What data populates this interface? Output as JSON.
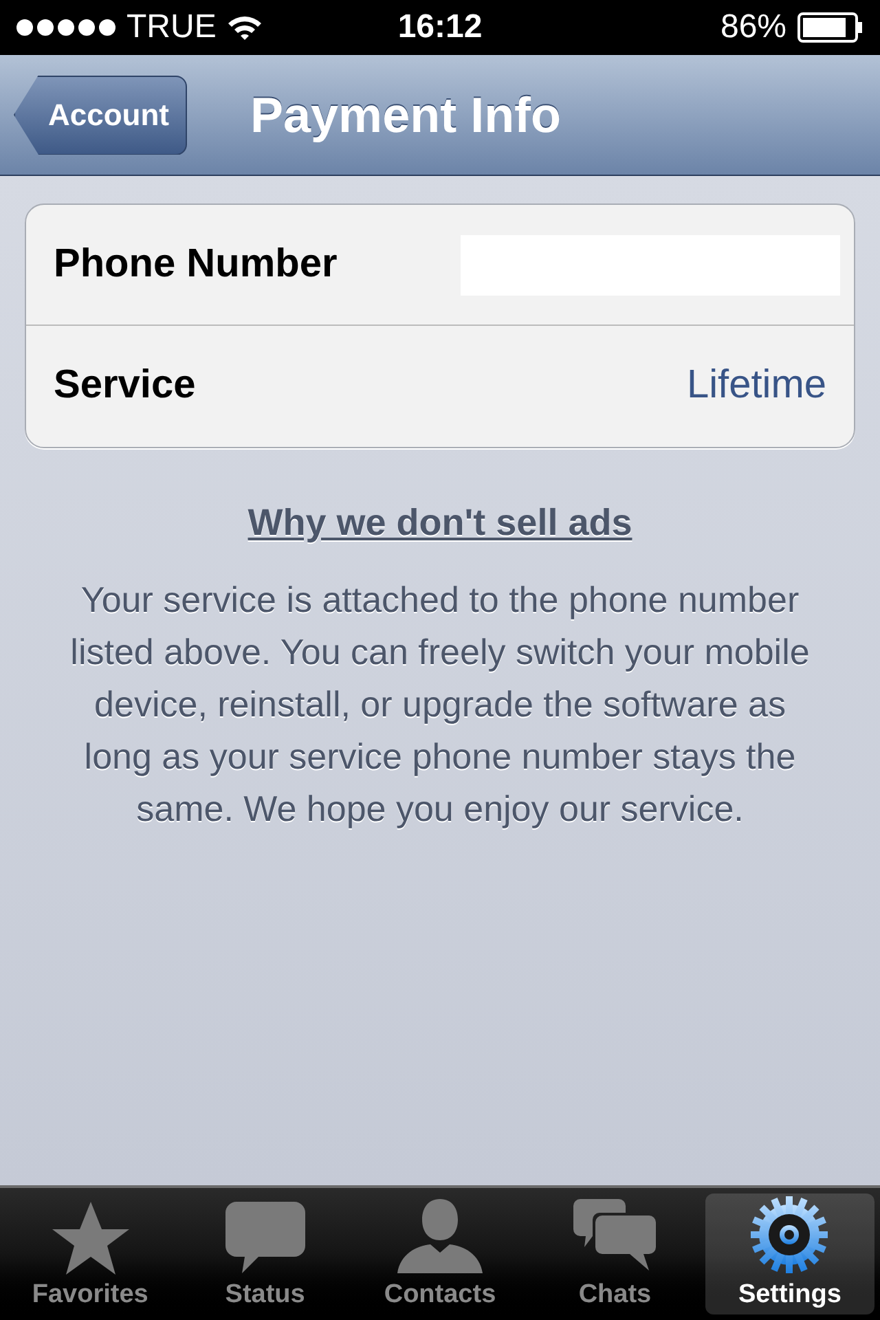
{
  "status_bar": {
    "carrier": "TRUE",
    "time": "16:12",
    "battery": "86%"
  },
  "nav_bar": {
    "back": "Account",
    "title": "Payment Info"
  },
  "rows": [
    {
      "label": "Phone Number",
      "kind": "input"
    },
    {
      "label": "Service",
      "kind": "value",
      "value": "Lifetime"
    }
  ],
  "link": "Why we don't sell ads",
  "description": "Your service is attached to the phone number listed above. You can freely switch your mobile device, reinstall, or upgrade the software as long as your service phone number stays the same. We hope you enjoy our service.",
  "tabs": [
    {
      "label": "Favorites",
      "selected": false
    },
    {
      "label": "Status",
      "selected": false
    },
    {
      "label": "Contacts",
      "selected": false
    },
    {
      "label": "Chats",
      "selected": false
    },
    {
      "label": "Settings",
      "selected": true
    }
  ]
}
